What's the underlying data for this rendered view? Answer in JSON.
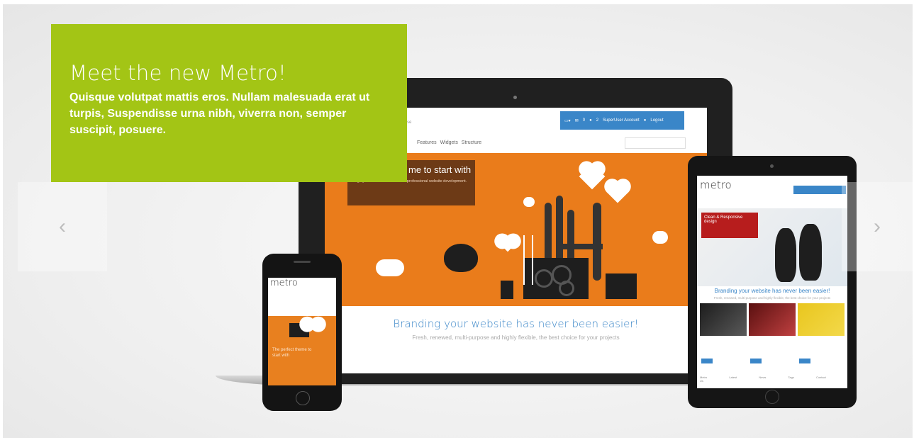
{
  "slider": {
    "caption": {
      "title": "Meet the new Metro!",
      "text": "Quisque volutpat mattis eros. Nullam malesuada erat ut turpis, Suspendisse urna nibh, viverra non, semper suscipit, posuere."
    },
    "nav": {
      "prev_icon": "‹",
      "next_icon": "›"
    },
    "colors": {
      "caption_bg": "#a3c515",
      "accent_blue": "#3a86c8",
      "accent_orange": "#ea7c1b"
    }
  },
  "laptop_screen": {
    "tagline": "...nchise",
    "topbar": {
      "badge_count": "0",
      "bell_count": "2",
      "account": "SuperUser Account",
      "logout": "Logout"
    },
    "menu": "Features  Widgets  Structure",
    "hero_title": "me to start with",
    "hero_sub": "...ighly customizable theme for professional website development.",
    "branding": "Branding your website has never been easier!",
    "fresh": "Fresh, renewed, multi-purpose and highly flexible, the best choice for your projects"
  },
  "tablet_screen": {
    "logo": "metro",
    "hero_box": "Clean & Responsive design",
    "branding": "Branding your website has never been easier!",
    "fresh": "Fresh, renewed, multi-purpose and highly flexible, the best choice for your projects",
    "footer_cols": "Metro  Latest News  Tags  Contact Us"
  },
  "phone_screen": {
    "logo": "metro",
    "hero_text": "The perfect theme to start with"
  }
}
